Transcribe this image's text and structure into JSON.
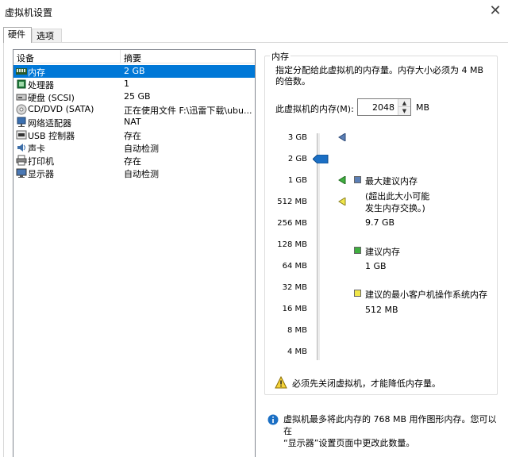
{
  "window": {
    "title": "虚拟机设置"
  },
  "tabs": [
    {
      "label": "硬件"
    },
    {
      "label": "选项"
    }
  ],
  "device_list": {
    "columns": {
      "device": "设备",
      "summary": "摘要"
    },
    "rows": [
      {
        "name": "内存",
        "summary": "2 GB",
        "icon": "memory-icon"
      },
      {
        "name": "处理器",
        "summary": "1",
        "icon": "processor-icon"
      },
      {
        "name": "硬盘 (SCSI)",
        "summary": "25 GB",
        "icon": "hard-disk-icon"
      },
      {
        "name": "CD/DVD (SATA)",
        "summary": "正在使用文件 F:\\迅雷下载\\ubu...",
        "icon": "cd-dvd-icon"
      },
      {
        "name": "网络适配器",
        "summary": "NAT",
        "icon": "network-adapter-icon"
      },
      {
        "name": "USB 控制器",
        "summary": "存在",
        "icon": "usb-icon"
      },
      {
        "name": "声卡",
        "summary": "自动检测",
        "icon": "sound-card-icon"
      },
      {
        "name": "打印机",
        "summary": "存在",
        "icon": "printer-icon"
      },
      {
        "name": "显示器",
        "summary": "自动检测",
        "icon": "display-icon"
      }
    ],
    "selected_index": 0
  },
  "memory": {
    "group_title": "内存",
    "description": "指定分配给此虚拟机的内存量。内存大小必须为 4 MB 的倍数。",
    "field_label": "此虚拟机的内存(M):",
    "value": "2048",
    "unit": "MB",
    "scale_labels": [
      "3 GB",
      "2 GB",
      "1 GB",
      "512 MB",
      "256 MB",
      "128 MB",
      "64 MB",
      "32 MB",
      "16 MB",
      "8 MB",
      "4 MB"
    ],
    "slider_level": "2 GB",
    "legend": {
      "max_label": "最大建议内存",
      "max_note_1": "(超出此大小可能",
      "max_note_2": "发生内存交换。)",
      "max_value": "9.7 GB",
      "rec_label": "建议内存",
      "rec_value": "1 GB",
      "min_label": "建议的最小客户机操作系统内存",
      "min_value": "512 MB"
    },
    "colors": {
      "max": "#5b7fb5",
      "recommended": "#3fae3f",
      "minimum": "#f0e64a"
    },
    "warning": "必须先关闭虚拟机，才能降低内存量。"
  },
  "info": {
    "line1": "虚拟机最多将此内存的 768 MB 用作图形内存。您可以在",
    "line2": "“显示器”设置页面中更改此数量。"
  }
}
